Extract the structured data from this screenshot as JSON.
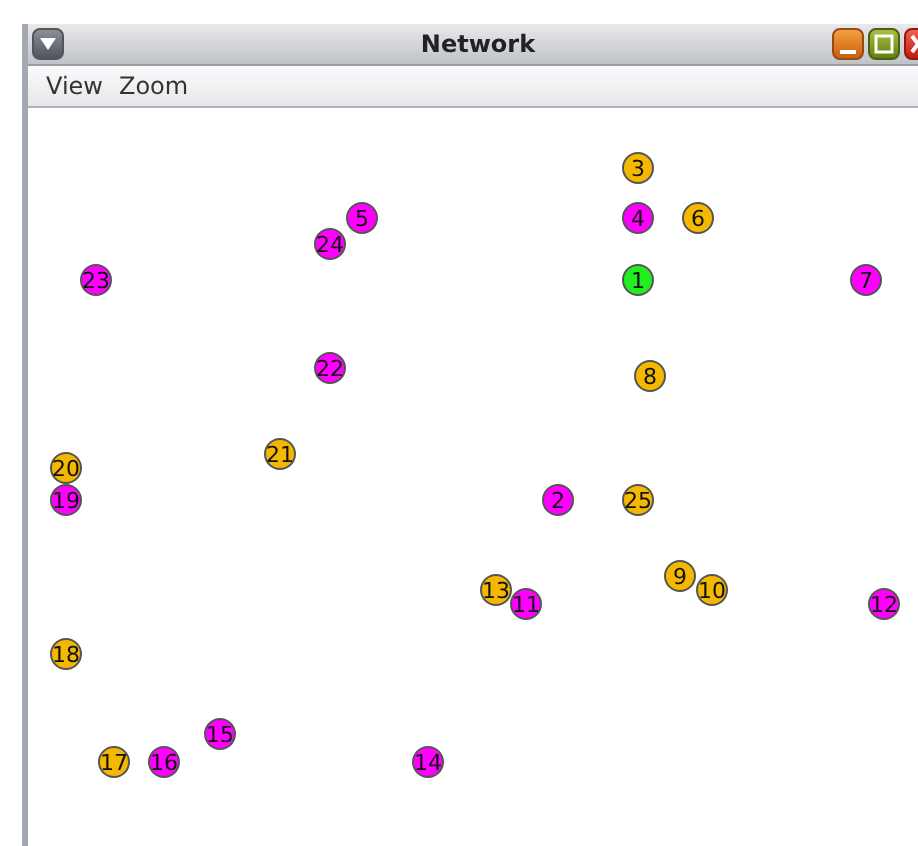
{
  "window": {
    "title": "Network"
  },
  "menu": [
    {
      "label": "View"
    },
    {
      "label": "Zoom"
    }
  ],
  "nodes": [
    {
      "label": "3",
      "color": "#f5b800"
    },
    {
      "label": "5",
      "color": "#ff00ff"
    },
    {
      "label": "4",
      "color": "#ff00ff"
    },
    {
      "label": "6",
      "color": "#f5b800"
    },
    {
      "label": "24",
      "color": "#ff00ff"
    },
    {
      "label": "23",
      "color": "#ff00ff"
    },
    {
      "label": "1",
      "color": "#22ee22"
    },
    {
      "label": "7",
      "color": "#ff00ff"
    },
    {
      "label": "22",
      "color": "#ff00ff"
    },
    {
      "label": "8",
      "color": "#f5b800"
    },
    {
      "label": "21",
      "color": "#f5b800"
    },
    {
      "label": "20",
      "color": "#f5b800"
    },
    {
      "label": "19",
      "color": "#ff00ff"
    },
    {
      "label": "2",
      "color": "#ff00ff"
    },
    {
      "label": "25",
      "color": "#f5b800"
    },
    {
      "label": "9",
      "color": "#f5b800"
    },
    {
      "label": "13",
      "color": "#f5b800"
    },
    {
      "label": "10",
      "color": "#f5b800"
    },
    {
      "label": "11",
      "color": "#ff00ff"
    },
    {
      "label": "12",
      "color": "#ff00ff"
    },
    {
      "label": "18",
      "color": "#f5b800"
    },
    {
      "label": "15",
      "color": "#ff00ff"
    },
    {
      "label": "17",
      "color": "#f5b800"
    },
    {
      "label": "16",
      "color": "#ff00ff"
    },
    {
      "label": "14",
      "color": "#ff00ff"
    }
  ]
}
